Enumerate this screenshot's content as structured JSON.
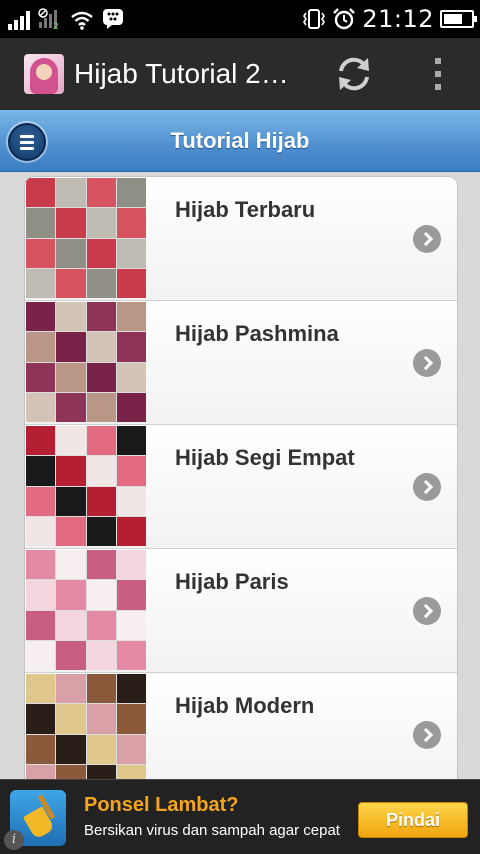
{
  "status_bar": {
    "time": "21:12",
    "battery_level": 0.7,
    "icons": [
      "signal-icon",
      "no-sim-signal-icon",
      "wifi-icon",
      "bbm-icon",
      "vibrate-icon",
      "alarm-icon",
      "battery-icon"
    ]
  },
  "action_bar": {
    "title": "Hijab Tutorial 2…",
    "icons": [
      "app-icon",
      "refresh-icon",
      "overflow-menu-icon"
    ]
  },
  "header": {
    "title": "Tutorial Hijab",
    "icon": "hamburger-menu-icon"
  },
  "list": {
    "items": [
      {
        "label": "Hijab Terbaru",
        "colors": [
          "#c93a4a",
          "#8f8f86",
          "#d85360",
          "#bfbdb3"
        ]
      },
      {
        "label": "Hijab Pashmina",
        "colors": [
          "#7a2348",
          "#b99686",
          "#8e3458",
          "#d4c4b8"
        ]
      },
      {
        "label": "Hijab Segi Empat",
        "colors": [
          "#b51f33",
          "#191919",
          "#e26b82",
          "#f0e6e6"
        ]
      },
      {
        "label": "Hijab Paris",
        "colors": [
          "#e58aa5",
          "#f4d6df",
          "#c85f83",
          "#f7eef0"
        ]
      },
      {
        "label": "Hijab Modern",
        "colors": [
          "#e0c78c",
          "#2a1e18",
          "#8a5a3a",
          "#d9a0a8"
        ]
      }
    ]
  },
  "ad": {
    "title": "Ponsel Lambat?",
    "description": "Bersikan virus dan sampah agar cepat",
    "button_label": "Pindai",
    "info_label": "i",
    "colors": {
      "title": "#f4a51c",
      "button": "#f0a60e"
    }
  },
  "colors": {
    "header": "#4f8fcf",
    "action_bar": "#2b2b2b"
  }
}
